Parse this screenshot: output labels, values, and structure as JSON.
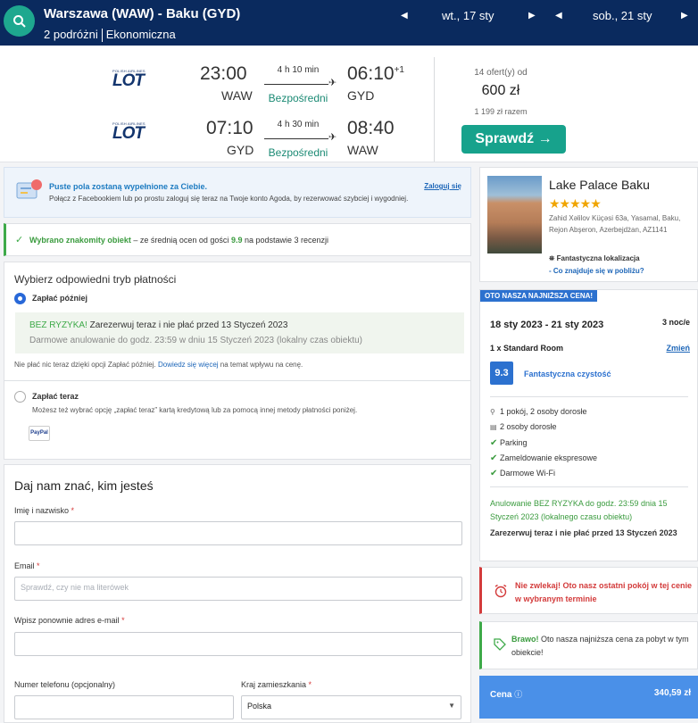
{
  "header": {
    "route": "Warszawa (WAW) - Baku (GYD)",
    "travellers": "2 podróżni",
    "cabin": "Ekonomiczna",
    "depart_date": "wt., 17 sty",
    "return_date": "sob., 21 sty"
  },
  "flight": {
    "outbound": {
      "dep_time": "23:00",
      "dep_code": "WAW",
      "duration": "4 h 10 min",
      "stops": "Bezpośredni",
      "arr_time": "06:10",
      "day_offset": "+1",
      "arr_code": "GYD"
    },
    "inbound": {
      "dep_time": "07:10",
      "dep_code": "GYD",
      "duration": "4 h 30 min",
      "stops": "Bezpośredni",
      "arr_time": "08:40",
      "arr_code": "WAW"
    },
    "airline_small": "POLISH AIRLINES",
    "airline": "LOT",
    "offers": "14 ofert(y) od",
    "price": "600 zł",
    "total": "1 199 zł razem",
    "check_button": "Sprawdź →"
  },
  "facebook": {
    "title": "Puste pola zostaną wypełnione za Ciebie.",
    "subtitle": "Połącz z Facebookiem lub po prostu zaloguj się teraz na Twoje konto Agoda, by rezerwować szybciej i wygodniej.",
    "login": "Zaloguj się"
  },
  "selected": {
    "bold": "Wybrano znakomity obiekt",
    "middle": " – ze średnią ocen od gości ",
    "score": "9.9",
    "end": " na podstawie 3 recenzji"
  },
  "payment": {
    "title": "Wybierz odpowiedni tryb płatności",
    "later_label": "Zapłać później",
    "norisk_bold": "BEZ RYZYKA!",
    "norisk_text": " Zarezerwuj teraz i nie płać przed 13 Styczeń 2023",
    "cancel_text": "Darmowe anulowanie do godz. 23:59 w dniu 15 Styczeń 2023 (lokalny czas obiektu)",
    "info_pre": "Nie płać nic teraz dzięki opcji Zapłać później. ",
    "info_link": "Dowiedz się więcej",
    "info_post": " na temat wpływu na cenę.",
    "now_label": "Zapłać teraz",
    "now_text": "Możesz też wybrać opcję „zapłać teraz” kartą kredytową lub za pomocą innej metody płatności poniżej.",
    "paypal": "PayPal"
  },
  "contact": {
    "title": "Daj nam znać, kim jesteś",
    "name_label": "Imię i nazwisko",
    "email_label": "Email",
    "email_placeholder": "Sprawdź, czy nie ma literówek",
    "email2_label": "Wpisz ponownie adres e-mail",
    "phone_label": "Numer telefonu (opcjonalny)",
    "country_label": "Kraj zamieszkania",
    "country_value": "Polska",
    "required": "*"
  },
  "hotel": {
    "name": "Lake Palace Baku",
    "stars": "★★★★★",
    "address": "Zahid Xəlilov Küçəsi 63a, Yasamal, Baku, Rejon Abşeron, Azerbejdżan, AZ1141",
    "location": "Fantastyczna lokalizacja",
    "nearby": "- Co znajduje się w pobliżu?"
  },
  "booking": {
    "ribbon": "OTO NASZA NAJNIŻSZA CENA!",
    "dates": "18 sty 2023 - 21 sty 2023",
    "nights": "3 noc/e",
    "room": "1 x Standard Room",
    "change": "Zmień",
    "score": "9.3",
    "score_label": "Fantastyczna czystość",
    "features": [
      {
        "icon": "person-icon",
        "text": "1 pokój, 2 osoby dorosłe"
      },
      {
        "icon": "bed-icon",
        "text": "2 osoby dorosłe"
      },
      {
        "icon": "check-icon",
        "text": "Parking"
      },
      {
        "icon": "check-icon",
        "text": "Zameldowanie ekspresowe"
      },
      {
        "icon": "check-icon",
        "text": "Darmowe Wi-Fi"
      }
    ],
    "free_cancel": "Anulowanie BEZ RYZYKA do godz. 23:59 dnia 15 Styczeń 2023 (lokalnego czasu obiektu)",
    "pay_later": "Zarezerwuj teraz i nie płać przed 13 Styczeń 2023"
  },
  "alert": {
    "text": "Nie zwlekaj! Oto nasz ostatni pokój w tej cenie w wybranym terminie"
  },
  "good": {
    "bold": "Brawo!",
    "text": " Oto nasza najniższa cena za pobyt w tym obiekcie!"
  },
  "pricebar": {
    "label": "Cena",
    "value": "340,59 zł"
  },
  "colors": {
    "header": "#0a2a5e",
    "accent": "#17a28c",
    "blue": "#2c71cf",
    "green": "#3eaa49",
    "red": "#d33b3b"
  }
}
